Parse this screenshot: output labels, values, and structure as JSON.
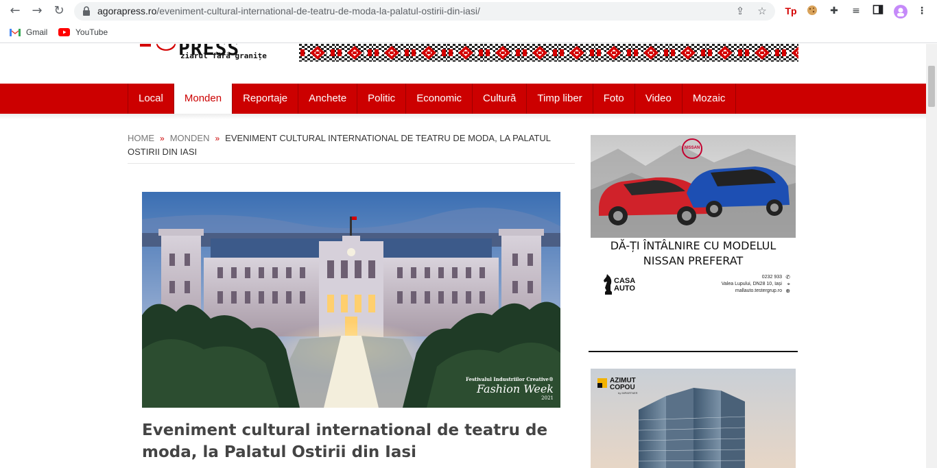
{
  "browser": {
    "url_host": "agorapress.ro",
    "url_path": "/eveniment-cultural-international-de-teatru-de-moda-la-palatul-ostirii-din-iasi/",
    "bookmarks": [
      {
        "label": "Gmail",
        "icon": "gmail-icon"
      },
      {
        "label": "YouTube",
        "icon": "youtube-icon"
      }
    ]
  },
  "site": {
    "logo_word": "PRESS",
    "tagline": "ziarul fără granițe"
  },
  "menu": {
    "items": [
      "Local",
      "Monden",
      "Reportaje",
      "Anchete",
      "Politic",
      "Economic",
      "Cultură",
      "Timp liber",
      "Foto",
      "Video",
      "Mozaic"
    ],
    "active": "Monden"
  },
  "breadcrumb": {
    "home": "HOME",
    "section": "MONDEN",
    "current": "EVENIMENT CULTURAL INTERNATIONAL DE TEATRU DE MODA, LA PALATUL OSTIRII DIN IASI"
  },
  "article": {
    "headline": "Eveniment cultural international de teatru de moda, la Palatul Ostirii din Iasi",
    "image_badge": {
      "line1": "Festivalul Industriilor Creative®",
      "line2": "Fashion Week",
      "year": "2021"
    }
  },
  "ad_nissan": {
    "brand": "NISSAN",
    "headline_1": "DĂ-ȚI ÎNTÂLNIRE CU MODELUL",
    "headline_2": "NISSAN PREFERAT",
    "dealer_1": "CASA",
    "dealer_2": "AUTO",
    "phone": "0232 933",
    "address": "Valea Lupului, DN28 10, Iași",
    "web": "mallauto.testergrup.ro"
  },
  "ad_azimut": {
    "line1": "AZIMUT",
    "line2": "COPOU",
    "sub": "by IMPARTNER"
  },
  "colors": {
    "brand_red": "#cc0000",
    "menu_border": "#9e0000"
  }
}
